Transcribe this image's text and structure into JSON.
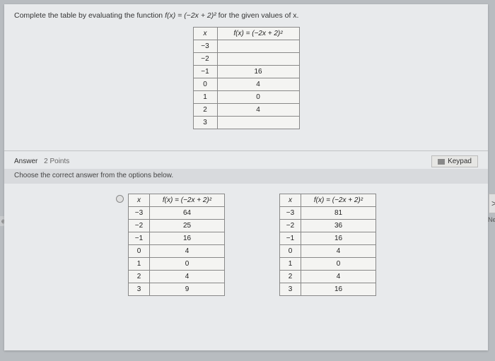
{
  "prompt_prefix": "Complete the table by evaluating the function ",
  "prompt_func": "f(x) = (−2x + 2)²",
  "prompt_suffix": " for the given values of x.",
  "header_x": "x",
  "header_fx": "f(x) = (−2x + 2)²",
  "main_table": [
    {
      "x": "−3",
      "fx": ""
    },
    {
      "x": "−2",
      "fx": ""
    },
    {
      "x": "−1",
      "fx": "16"
    },
    {
      "x": "0",
      "fx": "4"
    },
    {
      "x": "1",
      "fx": "0"
    },
    {
      "x": "2",
      "fx": "4"
    },
    {
      "x": "3",
      "fx": ""
    }
  ],
  "answer_label": "Answer",
  "points_label": "2 Points",
  "keypad_label": "Keypad",
  "subprompt": "Choose the correct answer from the options below.",
  "ev_label": "ev",
  "next_arrow": ">",
  "next_label": "Nex",
  "option_a": [
    {
      "x": "−3",
      "fx": "64"
    },
    {
      "x": "−2",
      "fx": "25"
    },
    {
      "x": "−1",
      "fx": "16"
    },
    {
      "x": "0",
      "fx": "4"
    },
    {
      "x": "1",
      "fx": "0"
    },
    {
      "x": "2",
      "fx": "4"
    },
    {
      "x": "3",
      "fx": "9"
    }
  ],
  "option_b": [
    {
      "x": "−3",
      "fx": "81"
    },
    {
      "x": "−2",
      "fx": "36"
    },
    {
      "x": "−1",
      "fx": "16"
    },
    {
      "x": "0",
      "fx": "4"
    },
    {
      "x": "1",
      "fx": "0"
    },
    {
      "x": "2",
      "fx": "4"
    },
    {
      "x": "3",
      "fx": "16"
    }
  ]
}
